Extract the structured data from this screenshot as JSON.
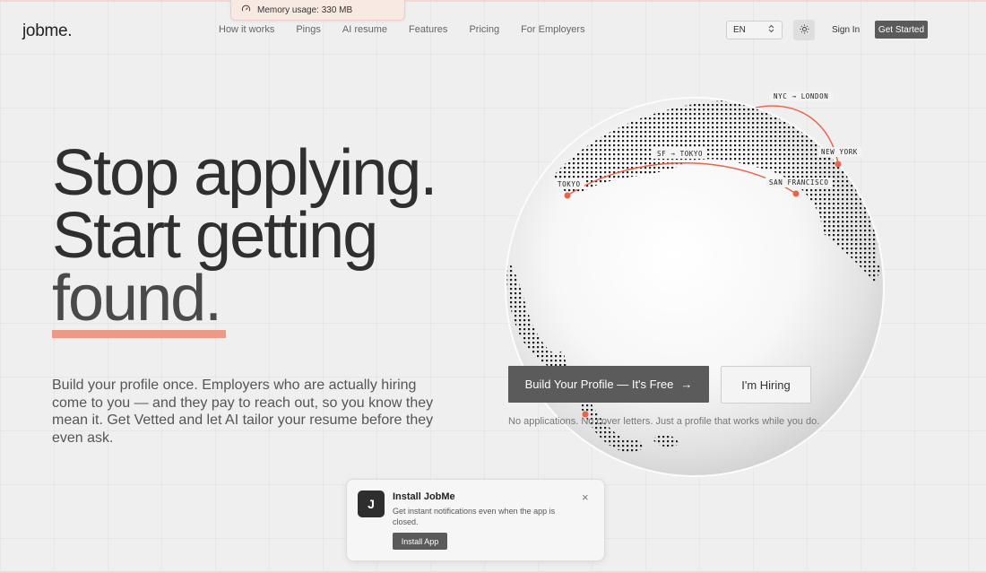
{
  "memory_toast": {
    "text": "Memory usage: 330 MB",
    "icon": "gauge-icon"
  },
  "header": {
    "logo": "jobme.",
    "nav": [
      "How it works",
      "Pings",
      "AI resume",
      "Features",
      "Pricing",
      "For Employers"
    ],
    "language": "EN",
    "theme_icon": "sun-icon",
    "sign_in": "Sign In",
    "get_started": "Get Started"
  },
  "hero": {
    "headline": [
      "Stop applying.",
      "Start getting",
      "found."
    ],
    "subtitle": "Build your profile once. Employers who are actually hiring come to you — and they pay to reach out, so you know they mean it. Get Vetted and let AI tailor your resume before they even ask.",
    "accent_color": "#ec9a85"
  },
  "globe": {
    "routes": [
      "NYC → LONDON",
      "SF → TOKYO"
    ],
    "cities": [
      "NEW YORK",
      "TOKYO",
      "SAN FRANCISCO"
    ],
    "route_color": "#e8644a"
  },
  "cta": {
    "primary": "Build Your Profile — It's Free",
    "primary_arrow": "→",
    "secondary": "I'm Hiring",
    "tagline": "No applications. No cover letters. Just a profile that works while you do."
  },
  "install_prompt": {
    "badge": "J",
    "title": "Install JobMe",
    "description": "Get instant notifications even when the app is closed.",
    "button": "Install App",
    "close": "×"
  }
}
